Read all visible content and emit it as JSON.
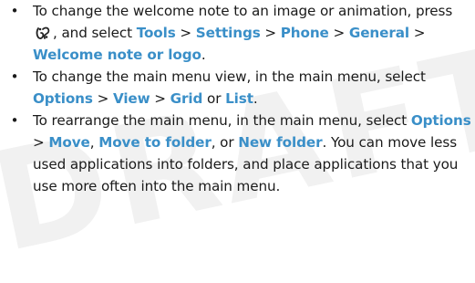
{
  "watermark": "DRAFT",
  "bullets": [
    {
      "segments": [
        {
          "text": "To change the welcome note to an image or animation, press ",
          "kw": false
        },
        {
          "icon": "menu-key-icon"
        },
        {
          "text": ", and select ",
          "kw": false
        },
        {
          "text": "Tools",
          "kw": true
        },
        {
          "text": " > ",
          "kw": false
        },
        {
          "text": "Settings",
          "kw": true
        },
        {
          "text": " > ",
          "kw": false
        },
        {
          "text": "Phone",
          "kw": true
        },
        {
          "text": " > ",
          "kw": false
        },
        {
          "text": "General",
          "kw": true
        },
        {
          "text": " > ",
          "kw": false
        },
        {
          "text": "Welcome note or logo",
          "kw": true
        },
        {
          "text": ".",
          "kw": false
        }
      ]
    },
    {
      "segments": [
        {
          "text": "To change the main menu view, in the main menu, select ",
          "kw": false
        },
        {
          "text": "Options",
          "kw": true
        },
        {
          "text": " > ",
          "kw": false
        },
        {
          "text": "View",
          "kw": true
        },
        {
          "text": " > ",
          "kw": false
        },
        {
          "text": "Grid",
          "kw": true
        },
        {
          "text": " or ",
          "kw": false
        },
        {
          "text": "List",
          "kw": true
        },
        {
          "text": ".",
          "kw": false
        }
      ]
    },
    {
      "segments": [
        {
          "text": "To rearrange the main menu, in the main menu, select ",
          "kw": false
        },
        {
          "text": "Options",
          "kw": true
        },
        {
          "text": " > ",
          "kw": false
        },
        {
          "text": "Move",
          "kw": true
        },
        {
          "text": ", ",
          "kw": false
        },
        {
          "text": "Move to folder",
          "kw": true
        },
        {
          "text": ", or ",
          "kw": false
        },
        {
          "text": "New folder",
          "kw": true
        },
        {
          "text": ". You can move less used applications into folders, and place applications that you use more often into the main menu.",
          "kw": false
        }
      ]
    }
  ],
  "colors": {
    "keyword": "#3a8fc8",
    "text": "#1a1a1a",
    "watermark": "#f1f1f1"
  }
}
